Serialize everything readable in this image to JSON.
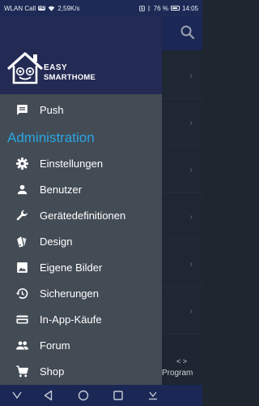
{
  "statusbar": {
    "carrier": "WLAN Call",
    "wifi_badge": "HD",
    "net_speed": "2,59K/s",
    "battery": "76 %",
    "time": "14:05"
  },
  "drawer": {
    "logo": {
      "line1": "EASY",
      "line2": "SMARTHOME"
    },
    "top_items": [
      {
        "label": "Push",
        "icon": "chat-icon"
      }
    ],
    "section_title": "Administration",
    "items": [
      {
        "label": "Einstellungen",
        "icon": "gear-icon"
      },
      {
        "label": "Benutzer",
        "icon": "person-icon"
      },
      {
        "label": "Gerätedefinitionen",
        "icon": "wrench-icon"
      },
      {
        "label": "Design",
        "icon": "palette-icon"
      },
      {
        "label": "Eigene Bilder",
        "icon": "image-icon"
      },
      {
        "label": "Sicherungen",
        "icon": "backup-icon"
      },
      {
        "label": "In-App-Käufe",
        "icon": "credit-card-icon"
      },
      {
        "label": "Forum",
        "icon": "people-icon"
      },
      {
        "label": "Shop",
        "icon": "cart-icon"
      }
    ]
  },
  "background": {
    "bottom_label": "Program"
  },
  "colors": {
    "header": "#232a54",
    "drawer": "#434b55",
    "accent": "#2aa7e3",
    "navbar": "#1b2754"
  }
}
